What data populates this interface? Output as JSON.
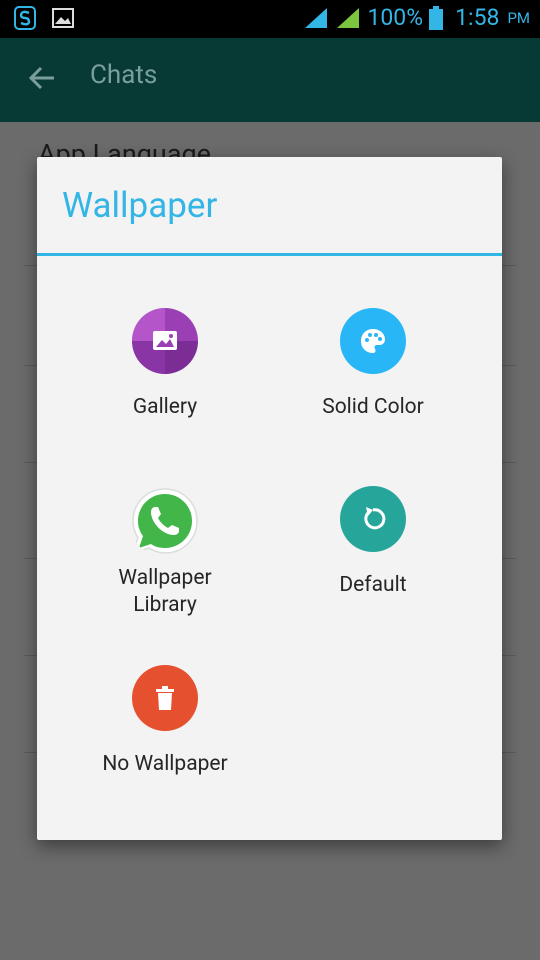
{
  "status_bar": {
    "battery": "100%",
    "time": "1:58",
    "ampm": "PM"
  },
  "app_bar": {
    "title": "Chats"
  },
  "background": {
    "first_setting": "App Language"
  },
  "dialog": {
    "title": "Wallpaper",
    "options": [
      {
        "label": "Gallery",
        "icon": "gallery-icon",
        "color": "#9b3fb5"
      },
      {
        "label": "Solid Color",
        "icon": "palette-icon",
        "color": "#29b6f6"
      },
      {
        "label": "Wallpaper\nLibrary",
        "icon": "whatsapp-icon",
        "color": "#4caf50"
      },
      {
        "label": "Default",
        "icon": "reset-icon",
        "color": "#26a69a"
      },
      {
        "label": "No Wallpaper",
        "icon": "trash-icon",
        "color": "#e5502f"
      }
    ]
  },
  "colors": {
    "accent": "#33b5e5",
    "app_bar": "#075e54",
    "scrim": "#6b6b6b",
    "dialog_bg": "#f3f3f3"
  }
}
